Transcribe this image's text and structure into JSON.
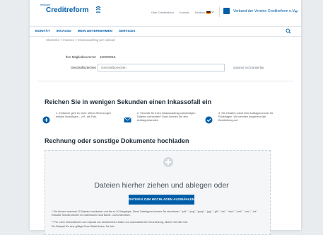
{
  "header": {
    "brand_pre": "exklusiv",
    "brand": "Creditreform",
    "links": [
      "Über Creditreform",
      "Kontakt",
      "Deutsch"
    ],
    "association": "Verband der Vereine Creditreform e.V."
  },
  "nav": {
    "items": [
      "BONITÄT",
      "INKASSO",
      "MEIN UNTERNEHMEN",
      "SERVICES"
    ]
  },
  "breadcrumb": "Startseite > Inkasso > Inkassoauftrag per Upload",
  "form": {
    "member_label": "Ihre Mitgliedsnummer",
    "member_value": "100000015",
    "ref_label": "Geschäftszeichen",
    "ref_placeholder": "Geschäftszeichen",
    "ref_hint": "optional, nicht änderbar"
  },
  "steps_heading": "Reichen Sie in wenigen Sekunden einen Inkassofall ein",
  "steps": [
    "1. Einfacher geht es nicht: offene Rechnungen einfach hinzufügen – z.B. als Foto.",
    "2. Sind alle für Ihren Inkassoauftrag notwendigen Dateien vorhanden? Dann können Sie den Auftrag absenden.",
    "3. Sie erhalten sofort eine Auftragsnummer für Rückfragen. Wir nehmen umgehend die Bearbeitung auf."
  ],
  "upload_heading": "Rechnung oder sonstige Dokumente hochladen",
  "upload": {
    "drop_text": "Dateien hierher ziehen und ablegen oder",
    "button": "DATEIEN ZUM HOCHLADEN AUSWÄHLEN *",
    "note1": "* Sie können maximal 10 Dateien hochladen und bis zu 10 Megabyte. Diese Dateitypen können Sie einreichen: \".pdf\", \".png\", \".jpeg\", \".jpg\", \".gif\", \".xls\", \".xlsx\", \".xml\", \".csv\", \".txt\". Erlaubte Sonderzeichen im Dateinamen sind Binde- und Unterstrich.",
    "note2": "** Für mehr Informationen zum Upload von strukturierten Daten zur automatisierten Verarbeitung, klicken Sie bitte hier.",
    "note3": "Ein Beispiel für eine gültige Excel-Datei finden Sie hier."
  },
  "colors": {
    "brand": "#005ea8",
    "heading": "#1f2d3a",
    "background": "#e9ecef"
  }
}
